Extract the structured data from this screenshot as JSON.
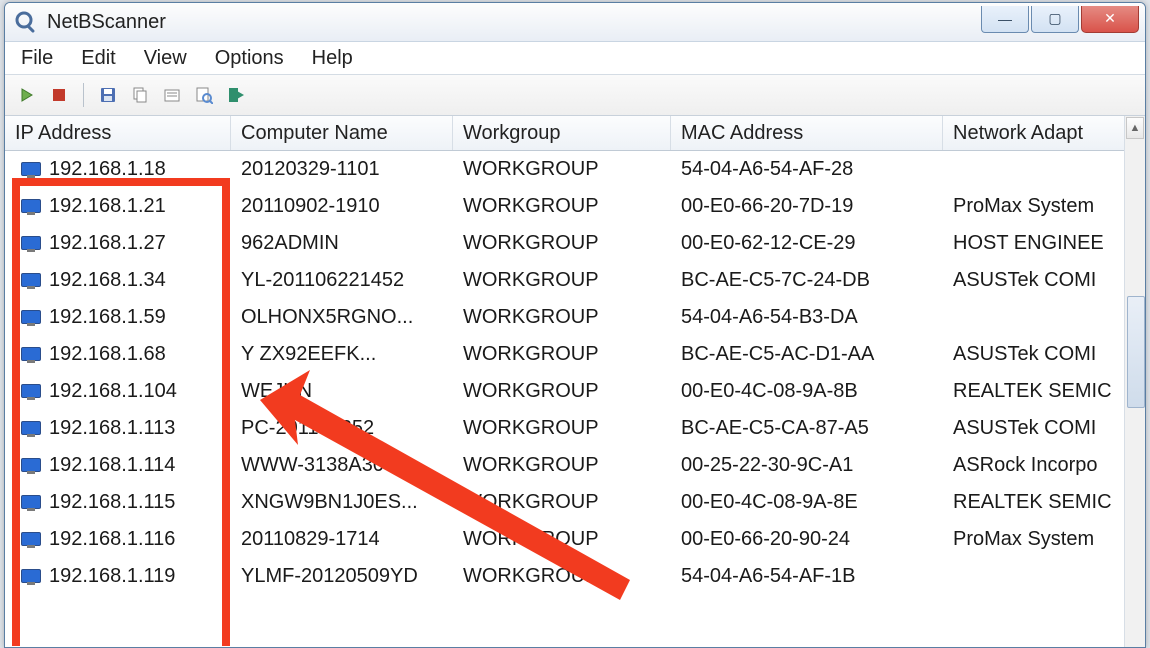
{
  "window": {
    "title": "NetBScanner"
  },
  "menu": {
    "file": "File",
    "edit": "Edit",
    "view": "View",
    "options": "Options",
    "help": "Help"
  },
  "toolbar": {
    "play": "play-icon",
    "stop": "stop-icon",
    "save": "save-icon",
    "copy": "copy-icon",
    "props": "properties-icon",
    "find": "find-icon",
    "exit": "exit-icon"
  },
  "columns": {
    "ip": "IP Address",
    "name": "Computer Name",
    "wg": "Workgroup",
    "mac": "MAC Address",
    "adapt": "Network Adapt"
  },
  "rows": [
    {
      "ip": "192.168.1.18",
      "name": "20120329-1101",
      "wg": "WORKGROUP",
      "mac": "54-04-A6-54-AF-28",
      "adapt": ""
    },
    {
      "ip": "192.168.1.21",
      "name": "20110902-1910",
      "wg": "WORKGROUP",
      "mac": "00-E0-66-20-7D-19",
      "adapt": "ProMax System"
    },
    {
      "ip": "192.168.1.27",
      "name": "962ADMIN",
      "wg": "WORKGROUP",
      "mac": "00-E0-62-12-CE-29",
      "adapt": "HOST ENGINEE"
    },
    {
      "ip": "192.168.1.34",
      "name": "YL-201106221452",
      "wg": "WORKGROUP",
      "mac": "BC-AE-C5-7C-24-DB",
      "adapt": "ASUSTek COMI"
    },
    {
      "ip": "192.168.1.59",
      "name": "OLHONX5RGNO...",
      "wg": "WORKGROUP",
      "mac": "54-04-A6-54-B3-DA",
      "adapt": ""
    },
    {
      "ip": "192.168.1.68",
      "name": "Y      ZX92EEFK...",
      "wg": "WORKGROUP",
      "mac": "BC-AE-C5-AC-D1-AA",
      "adapt": "ASUSTek COMI"
    },
    {
      "ip": "192.168.1.104",
      "name": "WEJUN",
      "wg": "WORKGROUP",
      "mac": "00-E0-4C-08-9A-8B",
      "adapt": "REALTEK SEMIC"
    },
    {
      "ip": "192.168.1.113",
      "name": "PC-201107252",
      "wg": "WORKGROUP",
      "mac": "BC-AE-C5-CA-87-A5",
      "adapt": "ASUSTek COMI"
    },
    {
      "ip": "192.168.1.114",
      "name": "WWW-3138A309...",
      "wg": "WORKGROUP",
      "mac": "00-25-22-30-9C-A1",
      "adapt": "ASRock Incorpo"
    },
    {
      "ip": "192.168.1.115",
      "name": "XNGW9BN1J0ES...",
      "wg": "WORKGROUP",
      "mac": "00-E0-4C-08-9A-8E",
      "adapt": "REALTEK SEMIC"
    },
    {
      "ip": "192.168.1.116",
      "name": "20110829-1714",
      "wg": "WORKGROUP",
      "mac": "00-E0-66-20-90-24",
      "adapt": "ProMax System"
    },
    {
      "ip": "192.168.1.119",
      "name": "YLMF-20120509YD",
      "wg": "WORKGROUP",
      "mac": "54-04-A6-54-AF-1B",
      "adapt": ""
    }
  ],
  "scroll": {
    "up": "▲",
    "down": "▼"
  },
  "controls": {
    "min": "—",
    "max": "▢",
    "close": "✕"
  }
}
